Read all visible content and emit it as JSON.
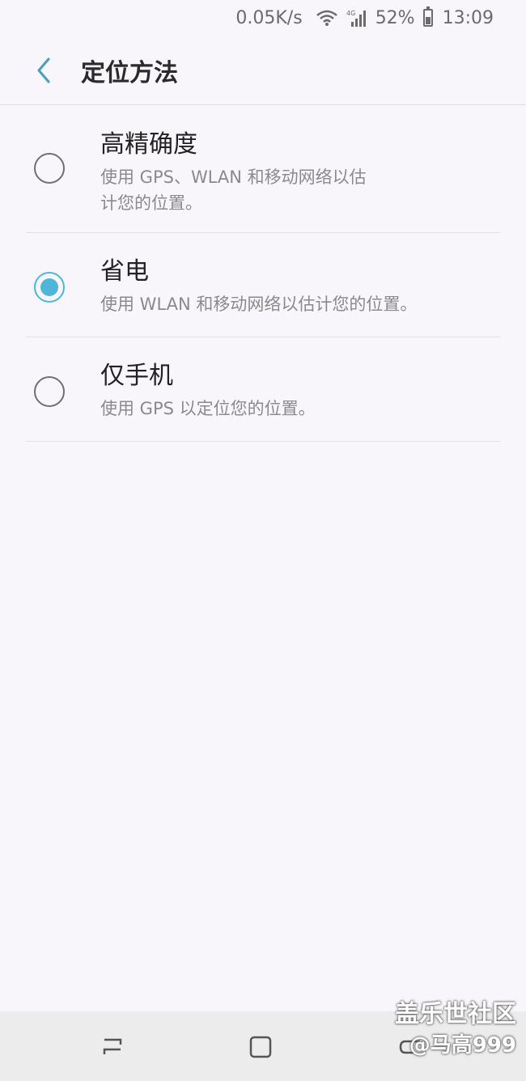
{
  "status_bar": {
    "net_speed": "0.05K/s",
    "network": "4G",
    "battery": "52%",
    "time": "13:09",
    "icons": [
      "wifi-icon",
      "signal-icon",
      "battery-icon"
    ]
  },
  "header": {
    "title": "定位方法",
    "back_icon": "chevron-left-icon"
  },
  "options": [
    {
      "title": "高精确度",
      "desc_line1": "使用 GPS、WLAN 和移动网络以估",
      "desc_line2": "计您的位置。",
      "selected": false
    },
    {
      "title": "省电",
      "desc_line1": "使用 WLAN 和移动网络以估计您的位置。",
      "selected": true
    },
    {
      "title": "仅手机",
      "desc_line1": "使用 GPS 以定位您的位置。",
      "selected": false
    }
  ],
  "nav_bar": {
    "icons": [
      "recent-apps-icon",
      "home-icon",
      "back-icon"
    ]
  },
  "watermark": {
    "line1": "盖乐世社区",
    "line2": "@马高999"
  },
  "colors": {
    "accent": "#4fb6d8",
    "background": "#f8f6fa",
    "navbar": "#ececec"
  }
}
